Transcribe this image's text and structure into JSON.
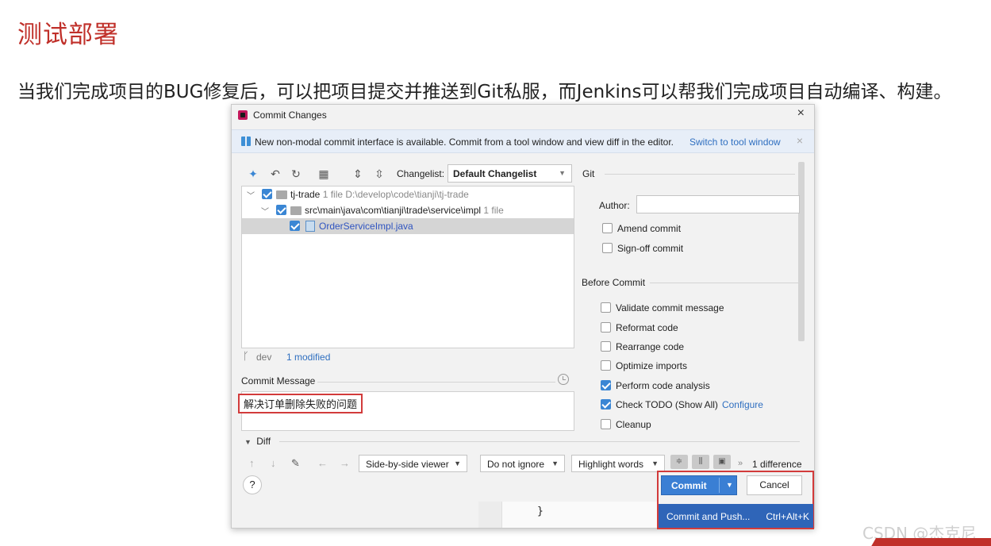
{
  "slide": {
    "title": "测试部署",
    "text": "当我们完成项目的BUG修复后，可以把项目提交并推送到Git私服，而Jenkins可以帮我们完成项目自动编译、构建。"
  },
  "dialog": {
    "title": "Commit Changes",
    "close": "×",
    "banner": {
      "text": "New non-modal commit interface is available. Commit from a tool window and view diff in the editor.",
      "link": "Switch to tool window",
      "close": "×"
    },
    "toolbar": {
      "changelist_label": "Changelist:",
      "changelist_value": "Default Changelist"
    },
    "tree": [
      {
        "name": "tj-trade",
        "info": "1 file  D:\\develop\\code\\tianji\\tj-trade"
      },
      {
        "name": "src\\main\\java\\com\\tianji\\trade\\service\\impl",
        "info": "1 file"
      },
      {
        "name": "OrderServiceImpl.java",
        "info": ""
      }
    ],
    "branch": {
      "name": "dev",
      "modified": "1 modified"
    },
    "commit_message": {
      "label": "Commit Message",
      "value": "解决订单删除失败的问题"
    },
    "git": {
      "section": "Git",
      "author_label": "Author:",
      "amend": "Amend commit",
      "signoff": "Sign-off commit"
    },
    "before_commit": {
      "section": "Before Commit",
      "options": [
        {
          "label": "Validate commit message",
          "checked": false
        },
        {
          "label": "Reformat code",
          "checked": false
        },
        {
          "label": "Rearrange code",
          "checked": false
        },
        {
          "label": "Optimize imports",
          "checked": false
        },
        {
          "label": "Perform code analysis",
          "checked": true
        },
        {
          "label": "Check TODO (Show All)",
          "checked": true,
          "link": "Configure"
        },
        {
          "label": "Cleanup",
          "checked": false
        }
      ]
    },
    "diff": {
      "label": "Diff",
      "viewer": "Side-by-side viewer",
      "ignore": "Do not ignore",
      "highlight": "Highlight words",
      "differences": "1 difference"
    },
    "buttons": {
      "help": "?",
      "commit": "Commit",
      "cancel": "Cancel",
      "commit_push": "Commit and Push...",
      "commit_push_shortcut": "Ctrl+Alt+K"
    },
    "code_brace": "}"
  },
  "watermark": "CSDN @杰克尼",
  "colors": {
    "title_red": "#c0302a",
    "accent_blue": "#3a7fd4",
    "highlight_red": "#d23b3b"
  }
}
